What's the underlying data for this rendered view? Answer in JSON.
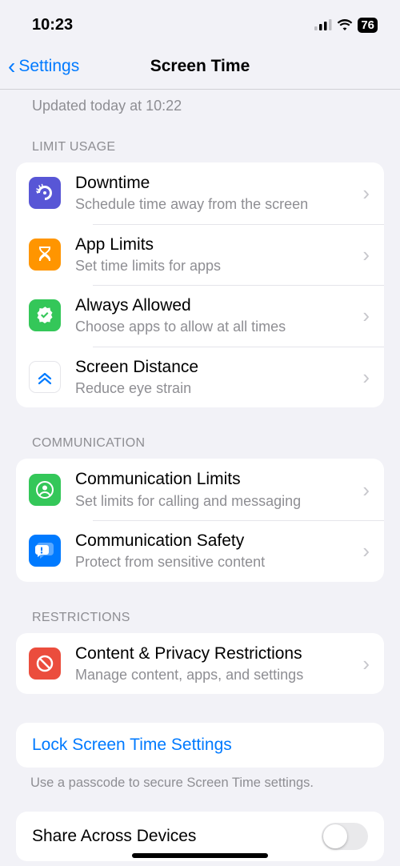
{
  "status": {
    "time": "10:23",
    "battery": "76"
  },
  "nav": {
    "back": "Settings",
    "title": "Screen Time"
  },
  "updated": "Updated today at 10:22",
  "sections": {
    "limit": {
      "header": "LIMIT USAGE",
      "rows": [
        {
          "title": "Downtime",
          "sub": "Schedule time away from the screen"
        },
        {
          "title": "App Limits",
          "sub": "Set time limits for apps"
        },
        {
          "title": "Always Allowed",
          "sub": "Choose apps to allow at all times"
        },
        {
          "title": "Screen Distance",
          "sub": "Reduce eye strain"
        }
      ]
    },
    "comm": {
      "header": "COMMUNICATION",
      "rows": [
        {
          "title": "Communication Limits",
          "sub": "Set limits for calling and messaging"
        },
        {
          "title": "Communication Safety",
          "sub": "Protect from sensitive content"
        }
      ]
    },
    "restrict": {
      "header": "RESTRICTIONS",
      "rows": [
        {
          "title": "Content & Privacy Restrictions",
          "sub": "Manage content, apps, and settings"
        }
      ]
    }
  },
  "lock": {
    "label": "Lock Screen Time Settings",
    "footer": "Use a passcode to secure Screen Time settings."
  },
  "share": {
    "label": "Share Across Devices"
  }
}
